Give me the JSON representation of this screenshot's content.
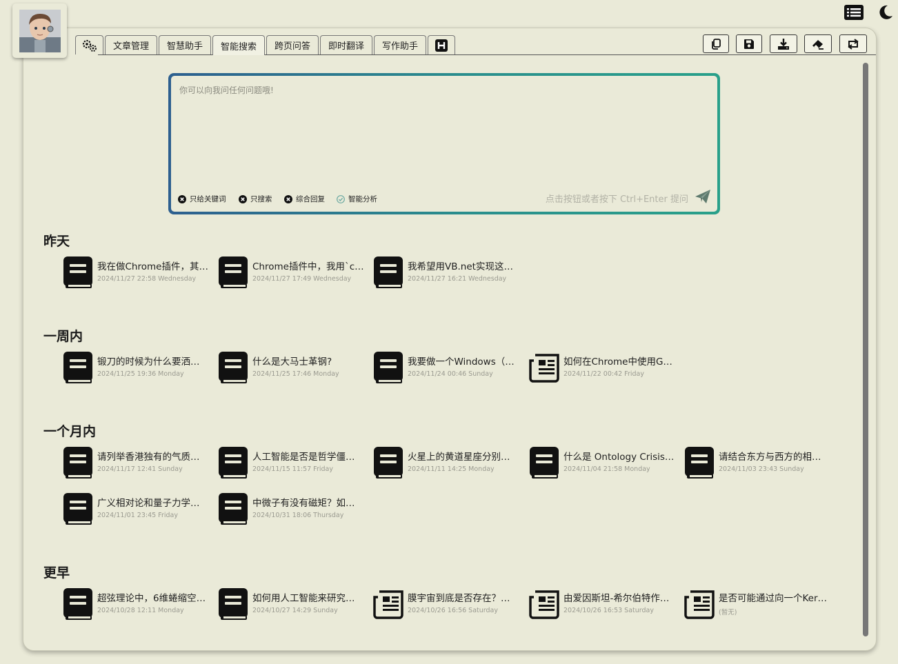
{
  "header": {
    "list_icon": "list-icon",
    "theme_icon": "moon-icon"
  },
  "avatar": {
    "icon": "robot-avatar"
  },
  "tabs": [
    {
      "label": "",
      "icon": "gears-icon"
    },
    {
      "label": "文章管理"
    },
    {
      "label": "智慧助手"
    },
    {
      "label": "智能搜索"
    },
    {
      "label": "跨页问答"
    },
    {
      "label": "即时翻译"
    },
    {
      "label": "写作助手"
    },
    {
      "label": "",
      "icon": "h-icon"
    }
  ],
  "active_tab": "智能搜索",
  "toolbar": [
    "copy-icon",
    "save-icon",
    "download-icon",
    "eraser-icon",
    "refresh-icon"
  ],
  "question": {
    "placeholder": "你可以向我问任何问题哦!",
    "options": [
      {
        "label": "只给关键词",
        "state": "off"
      },
      {
        "label": "只搜索",
        "state": "off"
      },
      {
        "label": "综合回复",
        "state": "off"
      },
      {
        "label": "智能分析",
        "state": "on"
      }
    ],
    "hint": "点击按钮或者按下 Ctrl+Enter 提问",
    "send_icon": "paper-plane-icon"
  },
  "sections": [
    {
      "title": "昨天",
      "items": [
        {
          "icon": "book-icon",
          "title": "我在做Chrome插件，其…",
          "date": "2024/11/27 22:58 Wednesday"
        },
        {
          "icon": "book-icon",
          "title": "Chrome插件中，我用`c…",
          "date": "2024/11/27 17:49 Wednesday"
        },
        {
          "icon": "book-icon",
          "title": "我希望用VB.net实现这…",
          "date": "2024/11/27 16:21 Wednesday"
        }
      ]
    },
    {
      "title": "一周内",
      "items": [
        {
          "icon": "book-icon",
          "title": "锻刀的时候为什么要洒…",
          "date": "2024/11/25 19:36 Monday"
        },
        {
          "icon": "book-icon",
          "title": "什么是大马士革钢?",
          "date": "2024/11/25 17:46 Monday"
        },
        {
          "icon": "book-icon",
          "title": "我要做一个Windows（…",
          "date": "2024/11/24 00:46 Sunday"
        },
        {
          "icon": "newspaper-icon",
          "title": "如何在Chrome中使用G…",
          "date": "2024/11/22 00:42 Friday"
        }
      ]
    },
    {
      "title": "一个月内",
      "items": [
        {
          "icon": "book-icon",
          "title": "请列举香港独有的气质…",
          "date": "2024/11/17 12:41 Sunday"
        },
        {
          "icon": "book-icon",
          "title": "人工智能是否是哲学僵…",
          "date": "2024/11/15 11:57 Friday"
        },
        {
          "icon": "book-icon",
          "title": "火星上的黄道星座分别…",
          "date": "2024/11/11 14:25 Monday"
        },
        {
          "icon": "book-icon",
          "title": "什么是 Ontology Crisis…",
          "date": "2024/11/04 21:58 Monday"
        },
        {
          "icon": "book-icon",
          "title": "请结合东方与西方的相…",
          "date": "2024/11/03 23:43 Sunday"
        },
        {
          "icon": "book-icon",
          "title": "广义相对论和量子力学…",
          "date": "2024/11/01 23:45 Friday"
        },
        {
          "icon": "book-icon",
          "title": "中微子有没有磁矩？如…",
          "date": "2024/10/31 18:06 Thursday"
        }
      ]
    },
    {
      "title": "更早",
      "items": [
        {
          "icon": "book-icon",
          "title": "超弦理论中，6维蜷缩空…",
          "date": "2024/10/28 12:11 Monday"
        },
        {
          "icon": "book-icon",
          "title": "如何用人工智能来研究…",
          "date": "2024/10/27 14:29 Sunday"
        },
        {
          "icon": "newspaper-icon",
          "title": "膜宇宙到底是否存在？…",
          "date": "2024/10/26 16:56 Saturday"
        },
        {
          "icon": "newspaper-icon",
          "title": "由爱因斯坦-希尔伯特作…",
          "date": "2024/10/26 16:53 Saturday"
        },
        {
          "icon": "newspaper-icon",
          "title": "是否可能通过向一个Ker…",
          "date": "(暂无)"
        }
      ]
    }
  ]
}
